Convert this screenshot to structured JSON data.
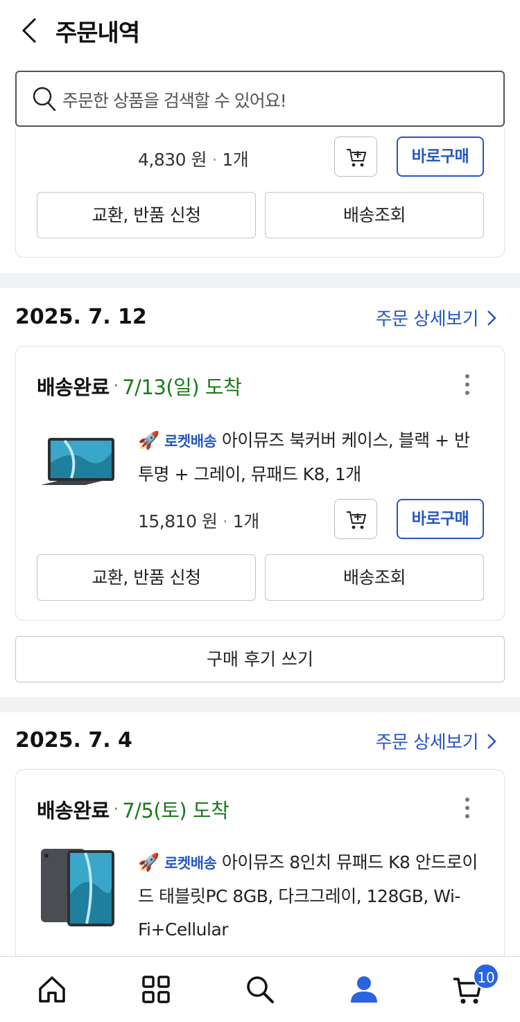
{
  "header": {
    "title": "주문내역"
  },
  "search": {
    "placeholder": "주문한 상품을 검색할 수 있어요!"
  },
  "order0": {
    "price": "4,830 원",
    "qty": "1개",
    "buy_label": "바로구매",
    "exchange_label": "교환, 반품 신청",
    "track_label": "배송조회"
  },
  "order1": {
    "date": "2025. 7. 12",
    "detail_label": "주문 상세보기",
    "status": "배송완료",
    "arrival": "7/13(일) 도착",
    "badge": "로켓배송",
    "name": "아이뮤즈 북커버 케이스, 블랙 + 반투명 + 그레이, 뮤패드 K8, 1개",
    "price": "15,810 원",
    "qty": "1개",
    "buy_label": "바로구매",
    "exchange_label": "교환, 반품 신청",
    "track_label": "배송조회",
    "review_label": "구매 후기 쓰기"
  },
  "order2": {
    "date": "2025. 7. 4",
    "detail_label": "주문 상세보기",
    "status": "배송완료",
    "arrival": "7/5(토) 도착",
    "badge": "로켓배송",
    "name": "아이뮤즈 8인치 뮤패드 K8 안드로이드 태블릿PC 8GB, 다크그레이, 128GB, Wi-Fi+Cellular"
  },
  "nav": {
    "items": [
      "home-icon",
      "category-grid-icon",
      "search-icon",
      "my-page-icon",
      "cart-icon"
    ],
    "cart_badge": "10"
  },
  "colors": {
    "accent": "#2457c5",
    "arrival_green": "#1a7a1a",
    "badge_blue": "#2a64e0"
  }
}
